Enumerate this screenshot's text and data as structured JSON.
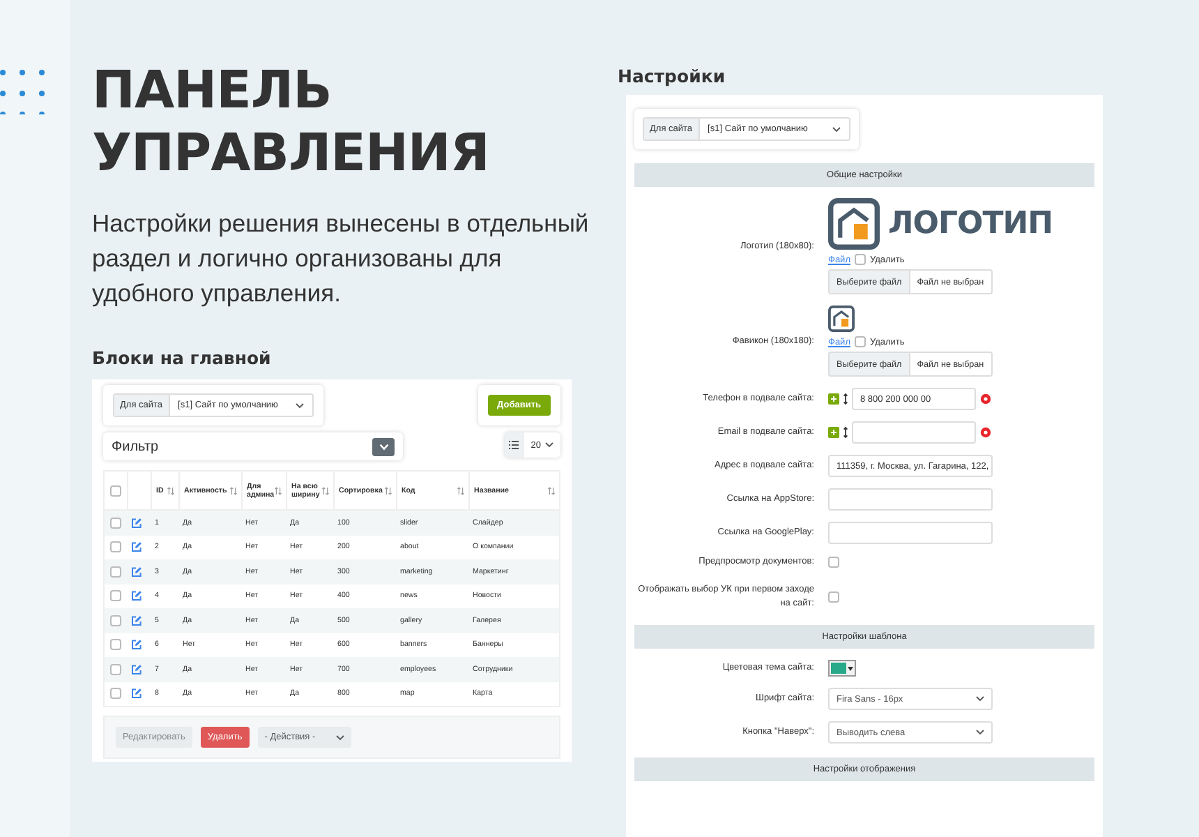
{
  "heading": "ПАНЕЛЬ УПРАВЛЕНИЯ",
  "description": "Настройки решения вынесены в отдельный раздел и логично организованы для удобного управления.",
  "blocks_panel": {
    "title": "Блоки на главной",
    "site_filter": {
      "label": "Для сайта",
      "value": "[s1] Сайт по умолчанию"
    },
    "add_button": "Добавить",
    "filter": {
      "label": "Фильтр"
    },
    "page_size": "20",
    "table": {
      "all_checked": false,
      "columns": [
        "ID",
        "Активность",
        "Для админа",
        "На всю ширину",
        "Сортировка",
        "Код",
        "Название"
      ],
      "rows": [
        {
          "checked": false,
          "cells": [
            "1",
            "Да",
            "Нет",
            "Да",
            "100",
            "slider",
            "Слайдер"
          ]
        },
        {
          "checked": false,
          "cells": [
            "2",
            "Да",
            "Нет",
            "Нет",
            "200",
            "about",
            "О компании"
          ]
        },
        {
          "checked": false,
          "cells": [
            "3",
            "Да",
            "Нет",
            "Нет",
            "300",
            "marketing",
            "Маркетинг"
          ]
        },
        {
          "checked": false,
          "cells": [
            "4",
            "Да",
            "Нет",
            "Нет",
            "400",
            "news",
            "Новости"
          ]
        },
        {
          "checked": false,
          "cells": [
            "5",
            "Да",
            "Нет",
            "Да",
            "500",
            "gallery",
            "Галерея"
          ]
        },
        {
          "checked": false,
          "cells": [
            "6",
            "Нет",
            "Нет",
            "Нет",
            "600",
            "banners",
            "Баннеры"
          ]
        },
        {
          "checked": false,
          "cells": [
            "7",
            "Да",
            "Нет",
            "Нет",
            "700",
            "employees",
            "Сотрудники"
          ]
        },
        {
          "checked": false,
          "cells": [
            "8",
            "Да",
            "Нет",
            "Да",
            "800",
            "map",
            "Карта"
          ]
        }
      ]
    },
    "edit_button": "Редактировать",
    "delete_button": "Удалить",
    "actions_select": "- Действия -"
  },
  "settings_panel": {
    "title": "Настройки",
    "site_filter": {
      "label": "Для сайта",
      "value": "[s1] Сайт по умолчанию"
    },
    "sections": [
      {
        "title": "Общие настройки",
        "rows": [
          {
            "kind": "logo",
            "label": "Логотип (180x80):",
            "logo_text": "ЛОГОТИП",
            "file_link": "Файл",
            "delete_label": "Удалить",
            "delete_checked": false,
            "choose_button": "Выберите файл",
            "file_status": "Файл не выбран"
          },
          {
            "kind": "favicon",
            "label": "Фавикон (180x180):",
            "file_link": "Файл",
            "delete_label": "Удалить",
            "delete_checked": false,
            "choose_button": "Выберите файл",
            "file_status": "Файл не выбран"
          },
          {
            "kind": "multi_input",
            "label": "Телефон в подвале сайта:",
            "value": "8 800 200 000 00"
          },
          {
            "kind": "multi_input",
            "label": "Email в подвале сайта:"
          },
          {
            "kind": "input",
            "label": "Адрес в подвале сайта:",
            "value": "111359, г. Москва, ул. Гагарина, 122,"
          },
          {
            "kind": "input",
            "label": "Ссылка на AppStore:"
          },
          {
            "kind": "input",
            "label": "Ссылка на GooglePlay:"
          },
          {
            "kind": "checkbox",
            "label": "Предпросмотр документов:",
            "checked": false
          },
          {
            "kind": "checkbox",
            "label": "Отображать выбор УК при первом заходе на сайт:",
            "checked": false
          }
        ]
      },
      {
        "title": "Настройки шаблона",
        "rows": [
          {
            "kind": "color",
            "label": "Цветовая тема сайта:",
            "color": "#27a98a"
          },
          {
            "kind": "select",
            "label": "Шрифт сайта:",
            "value": "Fira Sans - 16px"
          },
          {
            "kind": "select",
            "label": "Кнопка \"Наверх\":",
            "value": "Выводить слева"
          }
        ]
      },
      {
        "title": "Настройки отображения"
      }
    ]
  }
}
